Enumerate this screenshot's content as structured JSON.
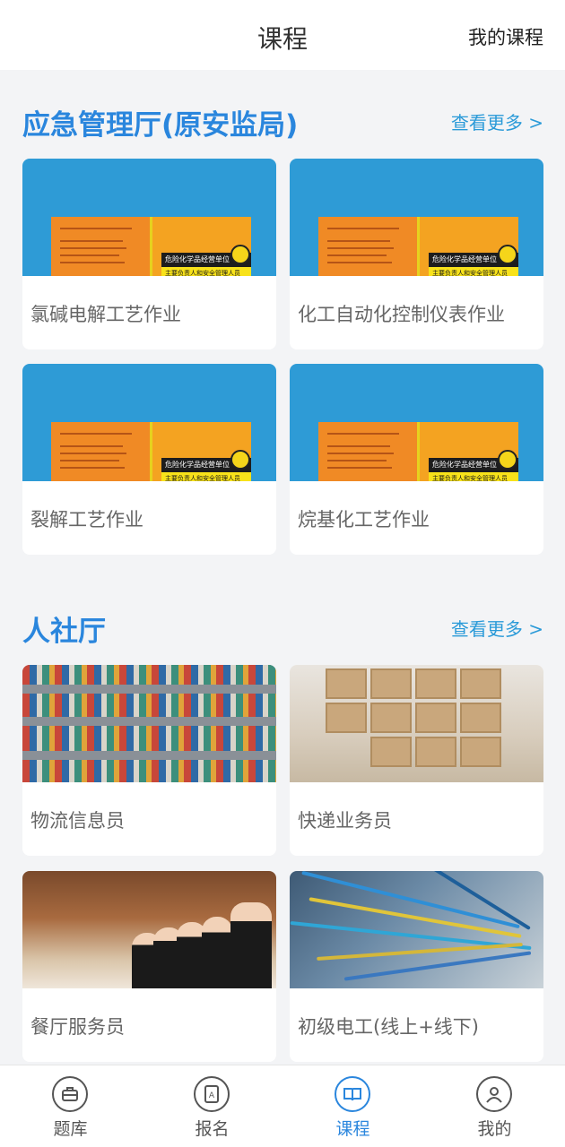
{
  "header": {
    "title": "课程",
    "my_courses": "我的课程"
  },
  "sections": [
    {
      "title": "应急管理厅(原安监局)",
      "see_more": "查看更多 >",
      "cards": [
        {
          "label": "氯碱电解工艺作业"
        },
        {
          "label": "化工自动化控制仪表作业"
        },
        {
          "label": "裂解工艺作业"
        },
        {
          "label": "烷基化工艺作业"
        }
      ]
    },
    {
      "title": "人社厅",
      "see_more": "查看更多 >",
      "cards": [
        {
          "label": "物流信息员"
        },
        {
          "label": "快递业务员"
        },
        {
          "label": "餐厅服务员"
        },
        {
          "label": "初级电工(线上+线下)"
        }
      ]
    }
  ],
  "book_cover": {
    "title": "危险化学品经营单位",
    "subtitle": "主要负责人和安全管理人员"
  },
  "tabs": [
    {
      "label": "题库",
      "icon": "briefcase-icon",
      "active": false
    },
    {
      "label": "报名",
      "icon": "document-icon",
      "active": false
    },
    {
      "label": "课程",
      "icon": "book-icon",
      "active": true
    },
    {
      "label": "我的",
      "icon": "user-icon",
      "active": false
    }
  ],
  "colors": {
    "accent": "#2a86dd",
    "link": "#2a9ad8",
    "background": "#f3f4f6"
  }
}
